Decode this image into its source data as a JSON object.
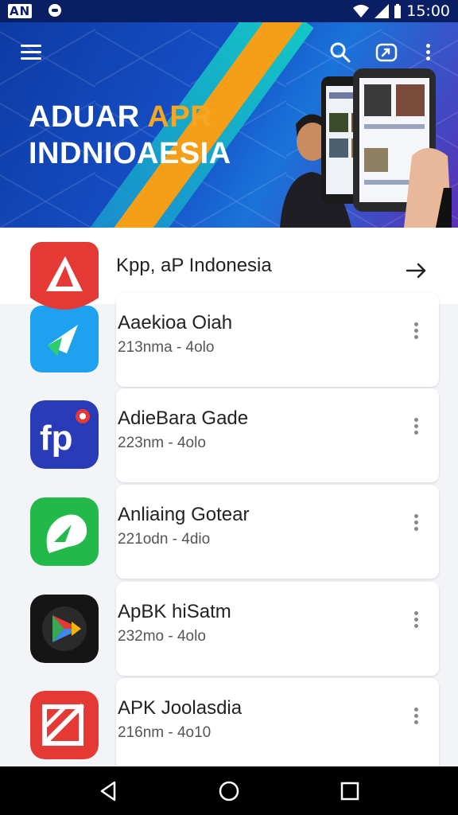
{
  "status_bar": {
    "carrier": "AN",
    "time": "15:00"
  },
  "hero": {
    "title_line1_part1": "ADUAR",
    "title_line1_part2": "APR",
    "title_line2": "INDNIOAESIA"
  },
  "featured": {
    "label": "Kpp, aP Indonesia"
  },
  "apps": [
    {
      "name": "Aaekioa Oiah",
      "meta": "213nma - 4olo",
      "icon": "red-white-arrow-icon"
    },
    {
      "name": "AdieBara Gade",
      "meta": "223nm - 4olo",
      "icon": "fp-logo-icon"
    },
    {
      "name": "Anliaing Gotear",
      "meta": "221odn - 4dio",
      "icon": "green-chat-icon"
    },
    {
      "name": "ApBK hiSatm",
      "meta": "232mo - 4olo",
      "icon": "play-store-icon"
    },
    {
      "name": "APK Joolasdia",
      "meta": "216nm - 4o10",
      "icon": "red-crossed-box-icon"
    }
  ],
  "colors": {
    "hero_blue": "#1650c7",
    "accent": "#f5a623",
    "status_bar": "#0a1f63"
  }
}
